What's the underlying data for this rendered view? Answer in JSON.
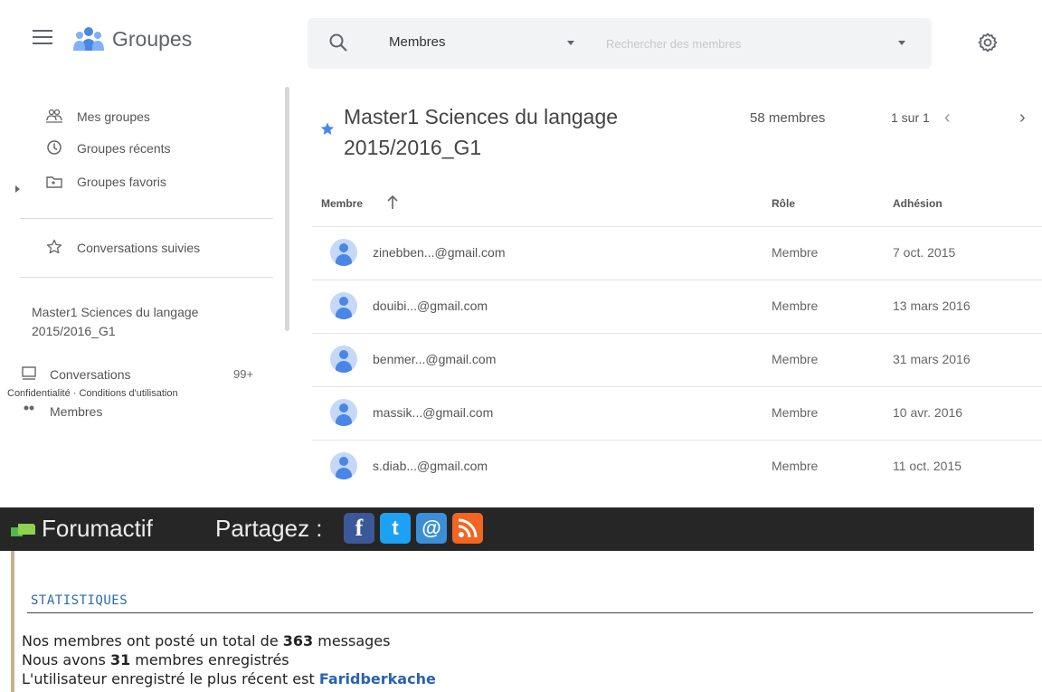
{
  "app": {
    "title": "Groupes"
  },
  "search": {
    "scope": "Membres",
    "placeholder": "Rechercher des membres"
  },
  "sidebar": {
    "items": [
      {
        "label": "Mes groupes",
        "icon": "groups-icon"
      },
      {
        "label": "Groupes récents",
        "icon": "clock-icon"
      },
      {
        "label": "Groupes favoris",
        "icon": "folder-star-icon"
      },
      {
        "label": "Conversations suivies",
        "icon": "star-outline-icon"
      }
    ],
    "group_name": "Master1 Sciences du langage 2015/2016_G1",
    "conversations": {
      "label": "Conversations",
      "count": "99+"
    },
    "members_label": "Membres",
    "footer": "Confidentialité · Conditions d'utilisation"
  },
  "group": {
    "title": "Master1 Sciences du langage 2015/2016_G1",
    "member_count": "58 membres",
    "page_info": "1 sur 1"
  },
  "table": {
    "headers": {
      "member": "Membre",
      "role": "Rôle",
      "joined": "Adhésion"
    },
    "rows": [
      {
        "email": "zinebben...@gmail.com",
        "role": "Membre",
        "date": "7 oct. 2015"
      },
      {
        "email": "douibi...@gmail.com",
        "role": "Membre",
        "date": "13 mars 2016"
      },
      {
        "email": "benmer...@gmail.com",
        "role": "Membre",
        "date": "31 mars 2016"
      },
      {
        "email": "massik...@gmail.com",
        "role": "Membre",
        "date": "10 avr. 2016"
      },
      {
        "email": "s.diab...@gmail.com",
        "role": "Membre",
        "date": "11 oct. 2015"
      }
    ]
  },
  "forum": {
    "brand": "Forumactif",
    "share_label": "Partagez :",
    "share_icons": [
      {
        "name": "facebook-icon",
        "glyph": "f",
        "color": "#3b5998"
      },
      {
        "name": "twitter-icon",
        "glyph": "t",
        "color": "#1da1f2"
      },
      {
        "name": "email-icon",
        "glyph": "@",
        "color": "#3b8fd6"
      },
      {
        "name": "rss-icon",
        "glyph": "",
        "color": "#f26522"
      }
    ],
    "stats_title": "STATISTIQUES",
    "line1": {
      "pre": "Nos membres ont posté un total de ",
      "value": "363",
      "post": " messages"
    },
    "line2": {
      "pre": "Nous avons ",
      "value": "31",
      "post": " membres enregistrés"
    },
    "line3": {
      "pre": "L'utilisateur enregistré le plus récent est ",
      "user": "Faridberkache"
    }
  },
  "colors": {
    "accent": "#4a86e8",
    "forum_bar": "#262626",
    "forum_link": "#2a62b0"
  }
}
